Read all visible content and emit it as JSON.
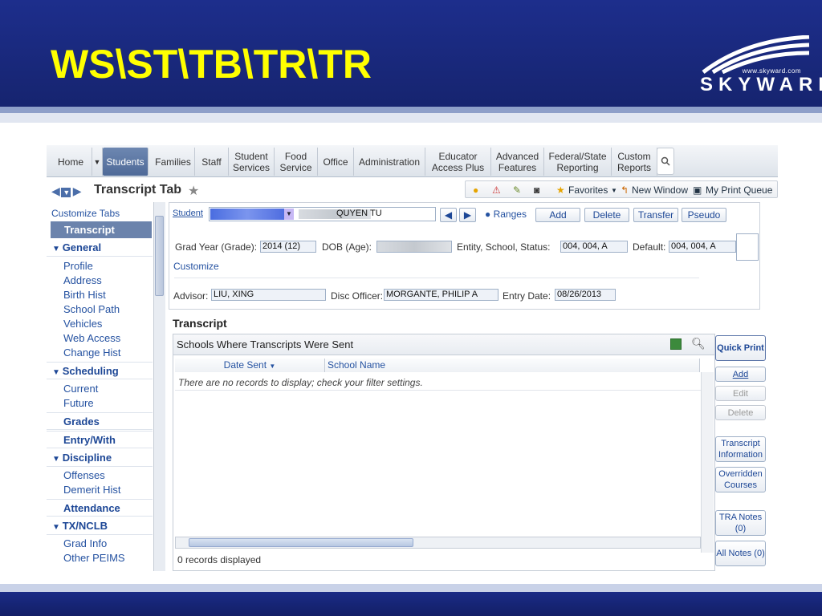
{
  "slide": {
    "title": "WS\\ST\\TB\\TR\\TR",
    "logo_url": "www.skyward.com",
    "logo_word": "SKYWARD",
    "logo_reg": "®"
  },
  "nav": {
    "items": [
      "Home",
      "Students",
      "Families",
      "Staff",
      "Student\nServices",
      "Food\nService",
      "Office",
      "Administration",
      "Educator\nAccess Plus",
      "Advanced\nFeatures",
      "Federal/State\nReporting",
      "Custom\nReports"
    ],
    "active": "Students"
  },
  "toolbar": {
    "page_title": "Transcript Tab",
    "favorites": "Favorites",
    "new_window": "New Window",
    "print_queue": "My Print Queue"
  },
  "sidebar": {
    "customize": "Customize Tabs",
    "selected": "Transcript",
    "general": "General",
    "general_items": [
      "Profile",
      "Address",
      "Birth Hist",
      "School Path",
      "Vehicles",
      "Web Access",
      "Change Hist"
    ],
    "scheduling": "Scheduling",
    "scheduling_items": [
      "Current",
      "Future"
    ],
    "grades": "Grades",
    "entry_with": "Entry/With",
    "discipline": "Discipline",
    "discipline_items": [
      "Offenses",
      "Demerit Hist"
    ],
    "attendance": "Attendance",
    "txnclb": "TX/NCLB",
    "txnclb_items": [
      "Grad Info",
      "Other PEIMS"
    ]
  },
  "student": {
    "label": "Student",
    "name": "QUYEN TU",
    "ranges": "Ranges",
    "buttons": [
      "Add",
      "Delete",
      "Transfer",
      "Pseudo"
    ],
    "grad_label": "Grad Year (Grade):",
    "grad_value": "2014 (12)",
    "dob_label": "DOB (Age):",
    "entity_label": "Entity, School, Status:",
    "entity_value": "004, 004, A",
    "default_label": "Default:",
    "default_value": "004, 004, A",
    "customize": "Customize",
    "advisor_label": "Advisor:",
    "advisor_value": "LIU, XING",
    "disc_label": "Disc Officer:",
    "disc_value": "MORGANTE, PHILIP A",
    "entry_label": "Entry Date:",
    "entry_value": "08/26/2013"
  },
  "transcript": {
    "section_title": "Transcript",
    "grid_title": "Schools Where Transcripts Were Sent",
    "col_date": "Date Sent",
    "col_school": "School Name",
    "empty_msg": "There are no records to display; check your filter settings.",
    "records": "0 records displayed",
    "buttons": {
      "quick_print": "Quick Print",
      "add": "Add",
      "edit": "Edit",
      "delete": "Delete",
      "transcript_info": "Transcript Information",
      "overridden": "Overridden Courses",
      "tra_notes": "TRA Notes (0)",
      "all_notes": "All Notes (0)"
    }
  }
}
